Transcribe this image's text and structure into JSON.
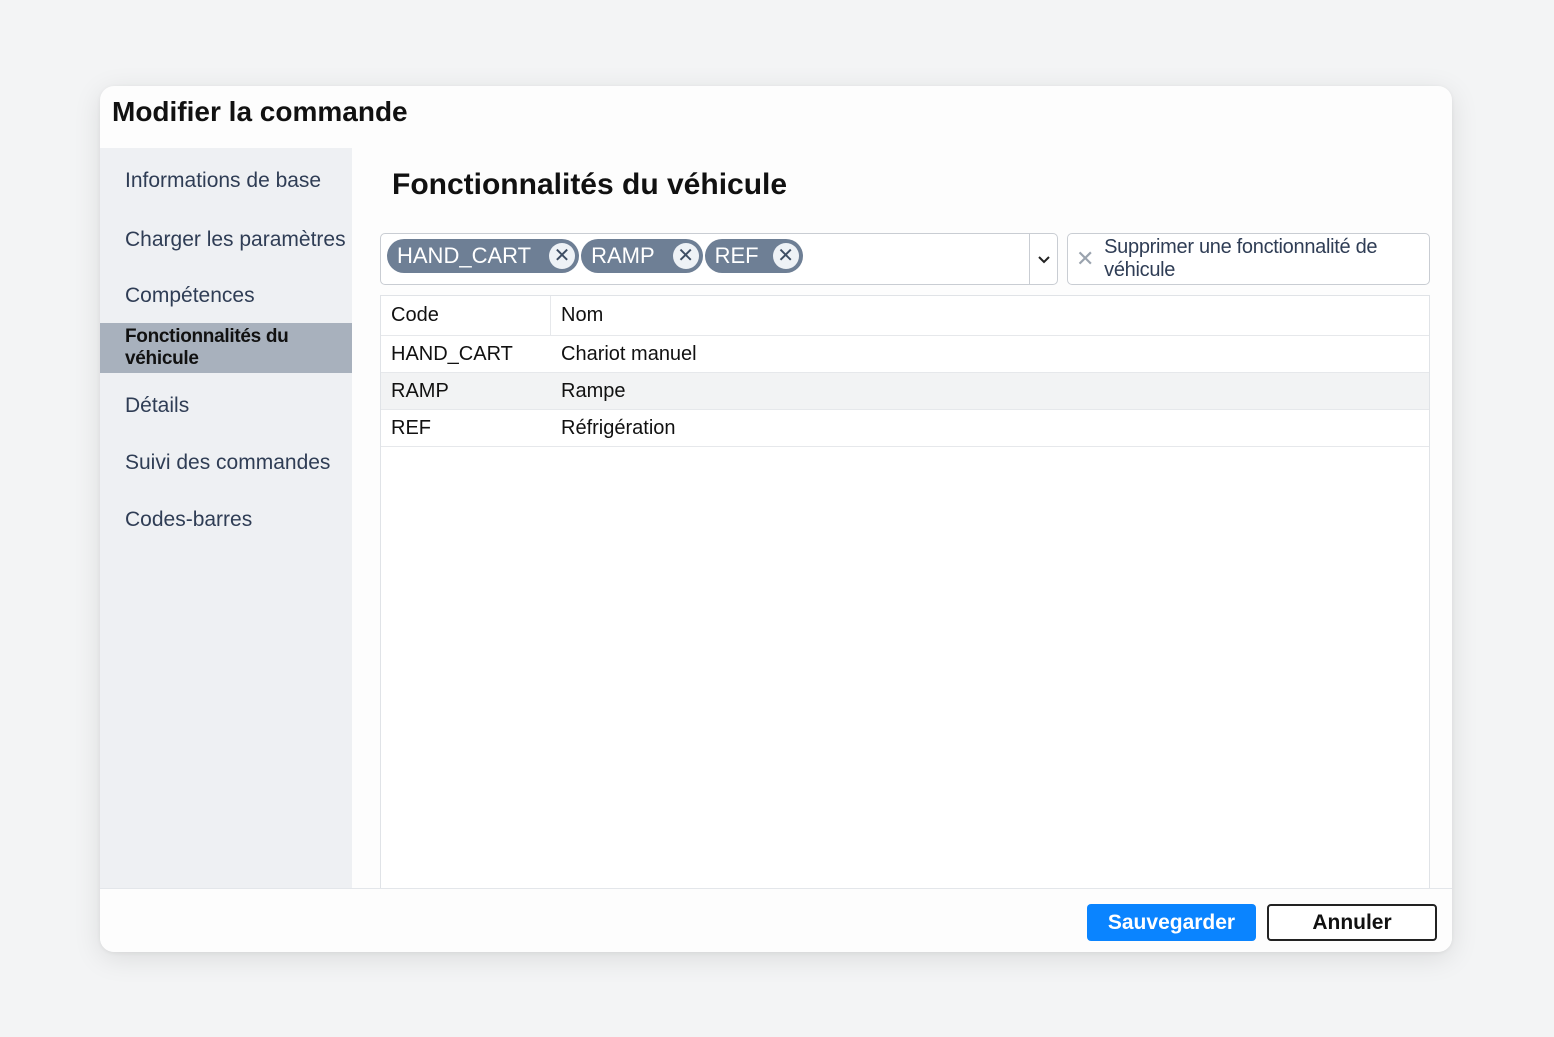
{
  "dialog": {
    "title": "Modifier la commande"
  },
  "sidebar": {
    "items": [
      {
        "label": "Informations de base",
        "active": false
      },
      {
        "label": "Charger les paramètres",
        "active": false
      },
      {
        "label": "Compétences",
        "active": false
      },
      {
        "label": "Fonctionnalités du véhicule",
        "active": true
      },
      {
        "label": "Détails",
        "active": false
      },
      {
        "label": "Suivi des commandes",
        "active": false
      },
      {
        "label": "Codes-barres",
        "active": false
      }
    ]
  },
  "main": {
    "title": "Fonctionnalités du véhicule",
    "selected_tags": [
      "HAND_CART",
      "RAMP",
      "REF"
    ],
    "remove_button_label": "Supprimer une fonctionnalité de véhicule",
    "table": {
      "columns": [
        "Code",
        "Nom"
      ],
      "rows": [
        {
          "code": "HAND_CART",
          "name": "Chariot manuel"
        },
        {
          "code": "RAMP",
          "name": "Rampe"
        },
        {
          "code": "REF",
          "name": "Réfrigération"
        }
      ]
    }
  },
  "footer": {
    "save_label": "Sauvegarder",
    "cancel_label": "Annuler"
  },
  "colors": {
    "accent": "#0a84ff",
    "tag_bg": "#6e7f95",
    "sidebar_active_bg": "#a8b1bd"
  }
}
